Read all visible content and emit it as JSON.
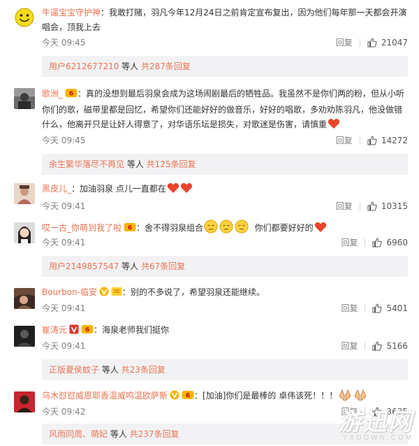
{
  "comments": [
    {
      "user": "牛逼宝宝守护神",
      "text": "：我敢打赌，羽凡今年12月24日之前肯定宣布复出，因为他们每年那一天都会开演唱会，顶我上去",
      "time": "今天 09:45",
      "reply": "回复",
      "likes": "21047",
      "sub": {
        "user": "用户6212677210",
        "middle": " 等人 ",
        "more": "共287条回复"
      }
    },
    {
      "user": "歌洲_",
      "text": "：真的没想到最后羽泉会成为这场闹剧最后的牺牲品。我虽然不是你们两的粉，但从小听你们的歌，磁带里都是回忆，希望你们还能好好的做音乐，好好的唱歌，多劝劝陈羽凡，他没做错什么，他离开只是让奸人得意了，对华语乐坛是损失，对歌迷是伤害，请慎重",
      "time": "今天 09:45",
      "reply": "回复",
      "likes": "14272",
      "sub": {
        "user": "余生繁华落尽不再见",
        "middle": " 等人 ",
        "more": "共125条回复"
      }
    },
    {
      "user": "黑皮儿_",
      "text": "：加油羽泉 点儿一直都在",
      "time": "今天 09:41",
      "reply": "回复",
      "likes": "10315"
    },
    {
      "user": "哎一古_你萌到我了啦",
      "text": "：舍不得羽泉组合",
      "text2": "你们都要好好的",
      "time": "今天 09:41",
      "reply": "回复",
      "likes": "6960",
      "sub": {
        "user": "用户2149857547",
        "middle": " 等人 ",
        "more": "共67条回复"
      }
    },
    {
      "user": "Bourbon-临安",
      "text": "：别的不多说了，希望羽泉还能继续。",
      "time": "今天 09:41",
      "reply": "回复",
      "likes": "5401"
    },
    {
      "user": "崔涛元",
      "text": "：海泉老师我们挺你",
      "time": "今天 09:41",
      "reply": "回复",
      "likes": "5166",
      "sub": {
        "user": "正版夏侯蚊子",
        "middle": " 等人 ",
        "more": "共23条回复"
      }
    },
    {
      "user": "乌木怼怼威恩耶香温威鸣温欧萨斯",
      "text": "：[加油]你们是最棒的 卓伟该死！！！",
      "time": "今天 09:42",
      "reply": "回复",
      "likes": "3635",
      "sub": {
        "user": "风雨同周、萌妃",
        "middle": " 等人 ",
        "more": "共237条回复"
      }
    }
  ],
  "watermark": {
    "main": "游迅网",
    "sub": "YXDOWN.COM"
  },
  "colors": {
    "username": "#eb7350",
    "sub_bg": "#f2f2f5",
    "heart": "#e8462b"
  }
}
